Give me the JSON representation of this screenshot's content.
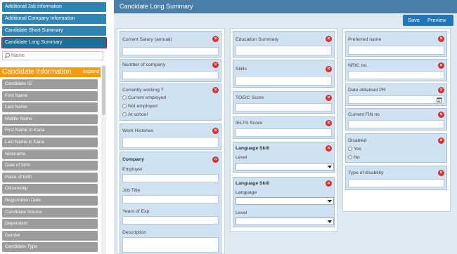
{
  "sidebar": {
    "nav": [
      {
        "label": "Additional Job Information"
      },
      {
        "label": "Additional Company Information"
      },
      {
        "label": "Candidate Short Summary"
      },
      {
        "label": "Candidate Long Summary"
      }
    ],
    "search_placeholder": "Name",
    "section_title": "Candidate Information",
    "section_toggle": "expand",
    "fields": [
      "Candidate ID",
      "First Name",
      "Last Name",
      "Middle Name",
      "First Name in Kana",
      "Last Name in Kana",
      "Nickname",
      "Date of birth",
      "Place of birth",
      "Citizenship",
      "Registration Date",
      "Candidate Source",
      "Dependent",
      "Gender",
      "Candidate Type"
    ]
  },
  "main": {
    "title": "Candidate Long Summary",
    "save_label": "Save",
    "preview_label": "Preview",
    "col1": {
      "current_salary": "Current Salary (annual)",
      "number_of_company": "Number of company",
      "currently_working": "Currently working ?",
      "options": [
        "Current employed",
        "Not employed",
        "At school"
      ],
      "work_histories": "Work Histories",
      "company_group": "Company",
      "employer": "Employer",
      "job_title": "Job Title",
      "years_of_exp": "Years of Exp",
      "description": "Description"
    },
    "col2": {
      "education_summary": "Education Summary",
      "skills": "Skills",
      "toeic": "TOEIC Score",
      "ielts": "IELTS Score",
      "lang1_title": "Language Skill",
      "lang1_level": "Level",
      "lang2_title": "Language Skill",
      "lang2_language": "Language",
      "lang2_level": "Level"
    },
    "col3": {
      "preferred_name": "Preferred name",
      "nric": "NRIC no.",
      "date_obtained_pr": "Date obtained PR",
      "current_fin": "Current FIN no",
      "disabled": "Disabled",
      "disabled_options": [
        "Yes",
        "No"
      ],
      "type_of_disability": "Type of disability"
    }
  },
  "colors": {
    "nav_blue": "#2f86b5",
    "header_orange": "#f39c12",
    "field_gray": "#9c9c9c",
    "card_blue": "#d0e2f2",
    "remove_red": "#d83030"
  }
}
